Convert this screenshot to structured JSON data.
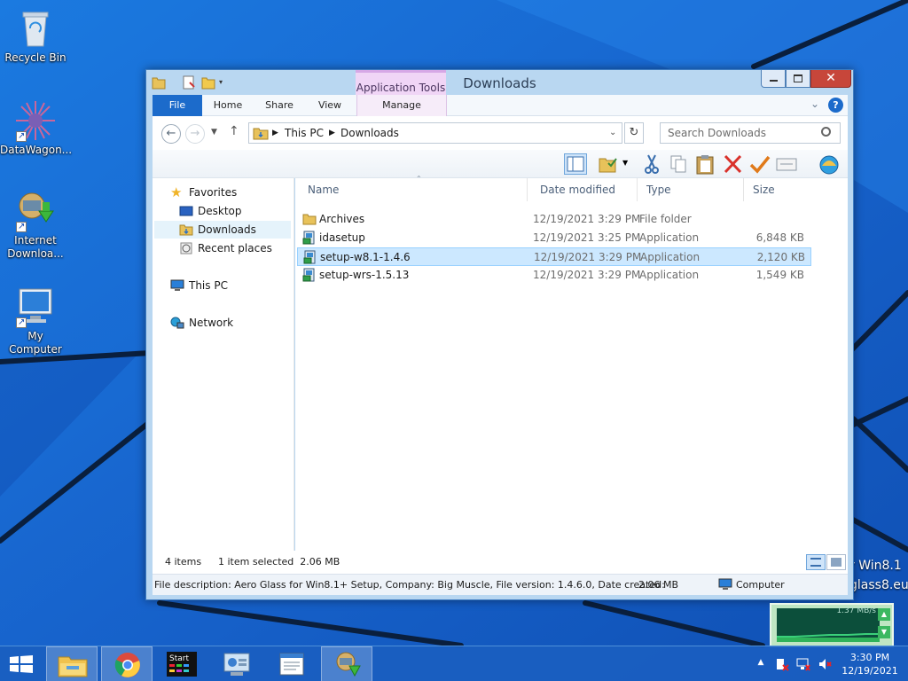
{
  "desktop": {
    "icons": [
      {
        "label": "Recycle Bin",
        "icon": "recycle-bin-icon"
      },
      {
        "label": "DataWagon...",
        "icon": "datawagon-icon"
      },
      {
        "label": "Internet Downloa...",
        "icon": "internet-download-manager-icon"
      },
      {
        "label": "My Computer",
        "icon": "my-computer-icon"
      }
    ],
    "watermark_line1": "r Win8.1",
    "watermark_line2": "glass8.eu"
  },
  "window": {
    "title": "Downloads",
    "context_tab_header": "Application Tools",
    "ribbon_tabs": {
      "file": "File",
      "home": "Home",
      "share": "Share",
      "view": "View",
      "manage": "Manage"
    },
    "address": {
      "crumbs": [
        "This PC",
        "Downloads"
      ]
    },
    "search": {
      "placeholder": "Search Downloads"
    },
    "nav": {
      "favorites": "Favorites",
      "desktop": "Desktop",
      "downloads": "Downloads",
      "recent": "Recent places",
      "this_pc": "This PC",
      "network": "Network"
    },
    "columns": {
      "name": "Name",
      "date": "Date modified",
      "type": "Type",
      "size": "Size"
    },
    "files": [
      {
        "name": "Archives",
        "date": "12/19/2021 3:29 PM",
        "type": "File folder",
        "size": "",
        "icon": "folder-icon",
        "selected": false
      },
      {
        "name": "idasetup",
        "date": "12/19/2021 3:25 PM",
        "type": "Application",
        "size": "6,848 KB",
        "icon": "setup-app-icon",
        "selected": false
      },
      {
        "name": "setup-w8.1-1.4.6",
        "date": "12/19/2021 3:29 PM",
        "type": "Application",
        "size": "2,120 KB",
        "icon": "setup-app-icon",
        "selected": true
      },
      {
        "name": "setup-wrs-1.5.13",
        "date": "12/19/2021 3:29 PM",
        "type": "Application",
        "size": "1,549 KB",
        "icon": "setup-app-icon",
        "selected": false
      }
    ],
    "status": {
      "item_count": "4 items",
      "selection": "1 item selected  2.06 MB"
    },
    "details": {
      "description": "File description: Aero Glass for Win8.1+ Setup, Company: Big Muscle, File version: 1.4.6.0, Date created:",
      "size": "2.06 MB",
      "location": "Computer"
    }
  },
  "net_widget": {
    "rate": "1.37 MB/s"
  },
  "taskbar": {
    "clock_time": "3:30 PM",
    "clock_date": "12/19/2021",
    "apps": [
      "file-explorer",
      "chrome",
      "start-app",
      "control-panel",
      "notepad-app",
      "internet-download-manager"
    ]
  },
  "colors": {
    "accent": "#1c6bcb",
    "desktop": "#1560c9",
    "selection": "#cce8ff",
    "context_tab": "#f0d5f6"
  }
}
